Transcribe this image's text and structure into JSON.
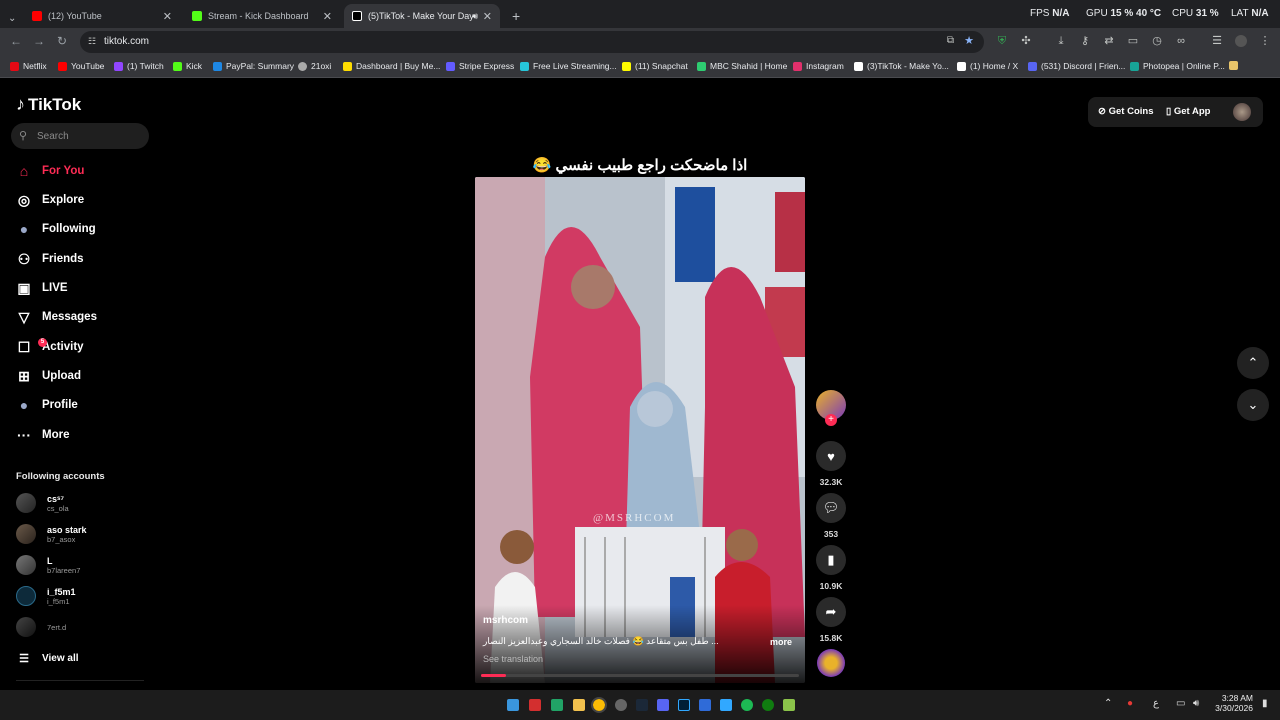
{
  "browser": {
    "tabs": [
      {
        "title": "(12) YouTube",
        "color": "#ff0000"
      },
      {
        "title": "Stream - Kick Dashboard",
        "color": "#53fc18"
      },
      {
        "title": "(5)TikTok - Make Your Day",
        "color": "#ffffff"
      }
    ],
    "new_tab": "+",
    "url": "tiktok.com",
    "overlay": {
      "fps_label": "FPS",
      "fps_value": "N/A",
      "gpu_label": "GPU",
      "gpu_value": "15 % 40 °C",
      "cpu_label": "CPU",
      "cpu_value": "31 %",
      "lat_label": "LAT",
      "lat_value": "N/A"
    },
    "bookmarks": [
      {
        "label": "Netflix",
        "color": "#e50914"
      },
      {
        "label": "YouTube",
        "color": "#ff0000"
      },
      {
        "label": "(1) Twitch",
        "color": "#9146ff"
      },
      {
        "label": "Kick",
        "color": "#53fc18"
      },
      {
        "label": "PayPal: Summary",
        "color": "#1e88e5"
      },
      {
        "label": "21oxi",
        "color": "#aaaaaa"
      },
      {
        "label": "Dashboard | Buy Me...",
        "color": "#ffdd00"
      },
      {
        "label": "Stripe Express",
        "color": "#635bff"
      },
      {
        "label": "Free Live Streaming...",
        "color": "#26c6da"
      },
      {
        "label": "(11) Snapchat",
        "color": "#fffc00"
      },
      {
        "label": "MBC Shahid | Home",
        "color": "#2ecc71"
      },
      {
        "label": "Instagram",
        "color": "#e1306c"
      },
      {
        "label": "(3)TikTok - Make Yo...",
        "color": "#ffffff"
      },
      {
        "label": "(1) Home / X",
        "color": "#ffffff"
      },
      {
        "label": "(531) Discord | Frien...",
        "color": "#5865f2"
      },
      {
        "label": "Photopea | Online P...",
        "color": "#18a497"
      }
    ]
  },
  "tiktok": {
    "logo": "TikTok",
    "search_placeholder": "Search",
    "nav": [
      {
        "label": "For You",
        "icon": "home-icon",
        "glyph": "⌂",
        "active": true
      },
      {
        "label": "Explore",
        "icon": "compass-icon",
        "glyph": "◎",
        "active": false
      },
      {
        "label": "Following",
        "icon": "following-avatar-icon",
        "glyph": "●",
        "active": false
      },
      {
        "label": "Friends",
        "icon": "friends-icon",
        "glyph": "⚇",
        "active": false
      },
      {
        "label": "LIVE",
        "icon": "live-icon",
        "glyph": "▣",
        "active": false
      },
      {
        "label": "Messages",
        "icon": "messages-icon",
        "glyph": "▽",
        "active": false
      },
      {
        "label": "Activity",
        "icon": "activity-icon",
        "glyph": "☐",
        "active": false,
        "badge": "5"
      },
      {
        "label": "Upload",
        "icon": "upload-icon",
        "glyph": "⊞",
        "active": false
      },
      {
        "label": "Profile",
        "icon": "profile-avatar-icon",
        "glyph": "●",
        "active": false
      },
      {
        "label": "More",
        "icon": "more-icon",
        "glyph": "···",
        "active": false
      }
    ],
    "following_title": "Following accounts",
    "following": [
      {
        "name": "csˢ⁷",
        "handle": "cs_ola"
      },
      {
        "name": "aso stark",
        "handle": "b7_asox"
      },
      {
        "name": "L",
        "handle": "b7lareen7"
      },
      {
        "name": "i_f5m1",
        "handle": "i_f5m1"
      },
      {
        "name": "",
        "handle": "7ert.d"
      }
    ],
    "view_all": "View all",
    "get_coins": "Get Coins",
    "get_app": "Get App",
    "video": {
      "caption": "اذا ماضحكت راجع طبيب نفسي 😂",
      "watermark": "@MSRHCOM",
      "author": "msrhcom",
      "description": "... طفل بس متقاعد 😂 فصلات خالد السجاري وعبدالعزيز النصار",
      "more": "more",
      "see_translation": "See translation",
      "progress": 0.08,
      "likes": "32.3K",
      "comments": "353",
      "saves": "10.9K",
      "shares": "15.8K"
    }
  },
  "taskbar": {
    "time": "3:28 AM",
    "date": "3/30/2026",
    "lang": "ع"
  }
}
